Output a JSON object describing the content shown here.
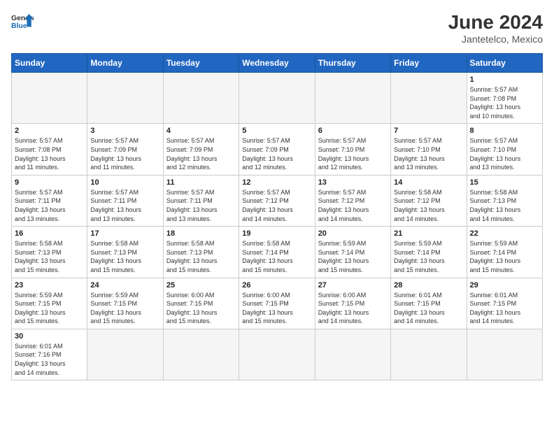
{
  "header": {
    "logo_general": "General",
    "logo_blue": "Blue",
    "title": "June 2024",
    "subtitle": "Jantetelco, Mexico"
  },
  "weekdays": [
    "Sunday",
    "Monday",
    "Tuesday",
    "Wednesday",
    "Thursday",
    "Friday",
    "Saturday"
  ],
  "weeks": [
    [
      {
        "day": "",
        "info": ""
      },
      {
        "day": "",
        "info": ""
      },
      {
        "day": "",
        "info": ""
      },
      {
        "day": "",
        "info": ""
      },
      {
        "day": "",
        "info": ""
      },
      {
        "day": "",
        "info": ""
      },
      {
        "day": "1",
        "info": "Sunrise: 5:57 AM\nSunset: 7:08 PM\nDaylight: 13 hours\nand 10 minutes."
      }
    ],
    [
      {
        "day": "2",
        "info": "Sunrise: 5:57 AM\nSunset: 7:08 PM\nDaylight: 13 hours\nand 11 minutes."
      },
      {
        "day": "3",
        "info": "Sunrise: 5:57 AM\nSunset: 7:09 PM\nDaylight: 13 hours\nand 11 minutes."
      },
      {
        "day": "4",
        "info": "Sunrise: 5:57 AM\nSunset: 7:09 PM\nDaylight: 13 hours\nand 12 minutes."
      },
      {
        "day": "5",
        "info": "Sunrise: 5:57 AM\nSunset: 7:09 PM\nDaylight: 13 hours\nand 12 minutes."
      },
      {
        "day": "6",
        "info": "Sunrise: 5:57 AM\nSunset: 7:10 PM\nDaylight: 13 hours\nand 12 minutes."
      },
      {
        "day": "7",
        "info": "Sunrise: 5:57 AM\nSunset: 7:10 PM\nDaylight: 13 hours\nand 13 minutes."
      },
      {
        "day": "8",
        "info": "Sunrise: 5:57 AM\nSunset: 7:10 PM\nDaylight: 13 hours\nand 13 minutes."
      }
    ],
    [
      {
        "day": "9",
        "info": "Sunrise: 5:57 AM\nSunset: 7:11 PM\nDaylight: 13 hours\nand 13 minutes."
      },
      {
        "day": "10",
        "info": "Sunrise: 5:57 AM\nSunset: 7:11 PM\nDaylight: 13 hours\nand 13 minutes."
      },
      {
        "day": "11",
        "info": "Sunrise: 5:57 AM\nSunset: 7:11 PM\nDaylight: 13 hours\nand 13 minutes."
      },
      {
        "day": "12",
        "info": "Sunrise: 5:57 AM\nSunset: 7:12 PM\nDaylight: 13 hours\nand 14 minutes."
      },
      {
        "day": "13",
        "info": "Sunrise: 5:57 AM\nSunset: 7:12 PM\nDaylight: 13 hours\nand 14 minutes."
      },
      {
        "day": "14",
        "info": "Sunrise: 5:58 AM\nSunset: 7:12 PM\nDaylight: 13 hours\nand 14 minutes."
      },
      {
        "day": "15",
        "info": "Sunrise: 5:58 AM\nSunset: 7:13 PM\nDaylight: 13 hours\nand 14 minutes."
      }
    ],
    [
      {
        "day": "16",
        "info": "Sunrise: 5:58 AM\nSunset: 7:13 PM\nDaylight: 13 hours\nand 15 minutes."
      },
      {
        "day": "17",
        "info": "Sunrise: 5:58 AM\nSunset: 7:13 PM\nDaylight: 13 hours\nand 15 minutes."
      },
      {
        "day": "18",
        "info": "Sunrise: 5:58 AM\nSunset: 7:13 PM\nDaylight: 13 hours\nand 15 minutes."
      },
      {
        "day": "19",
        "info": "Sunrise: 5:58 AM\nSunset: 7:14 PM\nDaylight: 13 hours\nand 15 minutes."
      },
      {
        "day": "20",
        "info": "Sunrise: 5:59 AM\nSunset: 7:14 PM\nDaylight: 13 hours\nand 15 minutes."
      },
      {
        "day": "21",
        "info": "Sunrise: 5:59 AM\nSunset: 7:14 PM\nDaylight: 13 hours\nand 15 minutes."
      },
      {
        "day": "22",
        "info": "Sunrise: 5:59 AM\nSunset: 7:14 PM\nDaylight: 13 hours\nand 15 minutes."
      }
    ],
    [
      {
        "day": "23",
        "info": "Sunrise: 5:59 AM\nSunset: 7:15 PM\nDaylight: 13 hours\nand 15 minutes."
      },
      {
        "day": "24",
        "info": "Sunrise: 5:59 AM\nSunset: 7:15 PM\nDaylight: 13 hours\nand 15 minutes."
      },
      {
        "day": "25",
        "info": "Sunrise: 6:00 AM\nSunset: 7:15 PM\nDaylight: 13 hours\nand 15 minutes."
      },
      {
        "day": "26",
        "info": "Sunrise: 6:00 AM\nSunset: 7:15 PM\nDaylight: 13 hours\nand 15 minutes."
      },
      {
        "day": "27",
        "info": "Sunrise: 6:00 AM\nSunset: 7:15 PM\nDaylight: 13 hours\nand 14 minutes."
      },
      {
        "day": "28",
        "info": "Sunrise: 6:01 AM\nSunset: 7:15 PM\nDaylight: 13 hours\nand 14 minutes."
      },
      {
        "day": "29",
        "info": "Sunrise: 6:01 AM\nSunset: 7:15 PM\nDaylight: 13 hours\nand 14 minutes."
      }
    ],
    [
      {
        "day": "30",
        "info": "Sunrise: 6:01 AM\nSunset: 7:16 PM\nDaylight: 13 hours\nand 14 minutes."
      },
      {
        "day": "",
        "info": ""
      },
      {
        "day": "",
        "info": ""
      },
      {
        "day": "",
        "info": ""
      },
      {
        "day": "",
        "info": ""
      },
      {
        "day": "",
        "info": ""
      },
      {
        "day": "",
        "info": ""
      }
    ]
  ]
}
